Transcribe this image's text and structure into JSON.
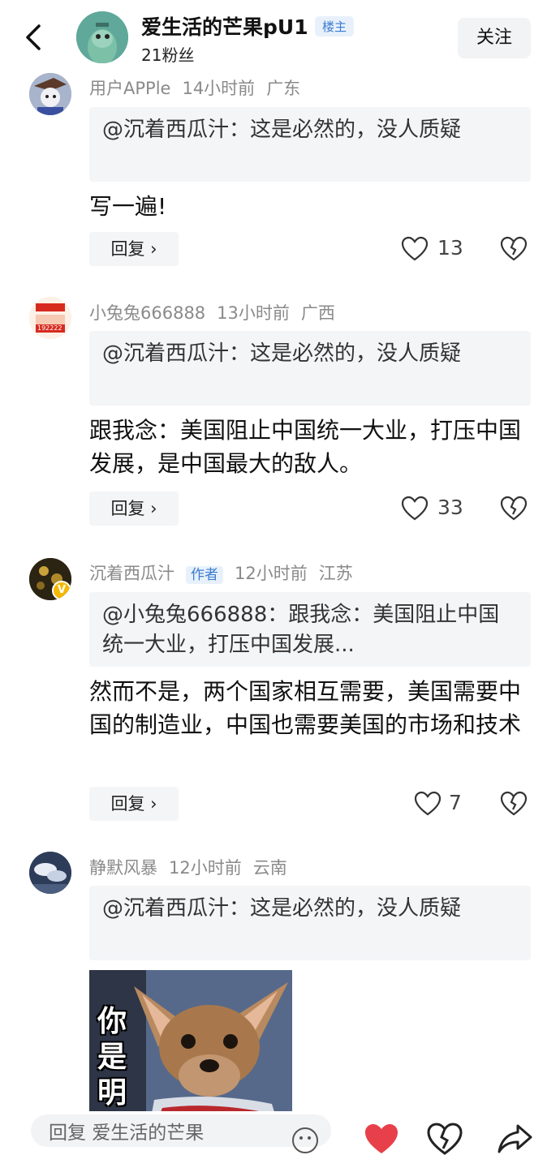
{
  "header": {
    "owner_name": "爱生活的芒果pU1",
    "owner_badge": "楼主",
    "fans": "21粉丝",
    "follow_label": "关注"
  },
  "comments": [
    {
      "user": "用户APPle",
      "time": "14小时前",
      "location": "广东",
      "quote": "@沉着西瓜汁：这是必然的，没人质疑",
      "text": "写一遍!",
      "reply_label": "回复 ›",
      "likes": "13"
    },
    {
      "user": "小兔兔666888",
      "time": "13小时前",
      "location": "广西",
      "quote": "@沉着西瓜汁：这是必然的，没人质疑",
      "text": "跟我念：美国阻止中国统一大业，打压中国发展，是中国最大的敌人。",
      "reply_label": "回复 ›",
      "likes": "33",
      "avatar_text": "192222"
    },
    {
      "user": "沉着西瓜汁",
      "author_tag": "作者",
      "time": "12小时前",
      "location": "江苏",
      "quote": "@小兔兔666888：跟我念：美国阻止中国统一大业，打压中国发展...",
      "text": "然而不是，两个国家相互需要，美国需要中国的制造业，中国也需要美国的市场和技术",
      "reply_label": "回复 ›",
      "likes": "7"
    },
    {
      "user": "静默风暴",
      "time": "12小时前",
      "location": "云南",
      "quote": "@沉着西瓜汁：这是必然的，没人质疑",
      "meme_text": "你是明白"
    }
  ],
  "bottom_bar": {
    "reply_placeholder": "回复 爱生活的芒果"
  },
  "colors": {
    "accent_blue": "#3b7ccf",
    "like_red": "#e8404a",
    "quote_bg": "#f4f5f7"
  }
}
